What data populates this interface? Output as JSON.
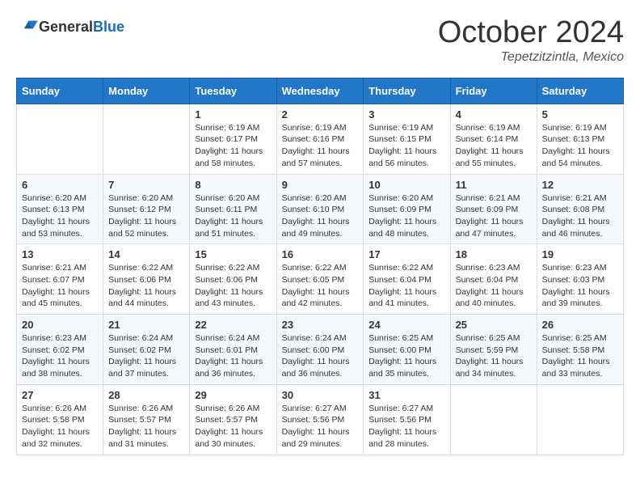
{
  "header": {
    "logo_general": "General",
    "logo_blue": "Blue",
    "month": "October 2024",
    "location": "Tepetzitzintla, Mexico"
  },
  "weekdays": [
    "Sunday",
    "Monday",
    "Tuesday",
    "Wednesday",
    "Thursday",
    "Friday",
    "Saturday"
  ],
  "weeks": [
    [
      {
        "day": "",
        "info": ""
      },
      {
        "day": "",
        "info": ""
      },
      {
        "day": "1",
        "info": "Sunrise: 6:19 AM\nSunset: 6:17 PM\nDaylight: 11 hours and 58 minutes."
      },
      {
        "day": "2",
        "info": "Sunrise: 6:19 AM\nSunset: 6:16 PM\nDaylight: 11 hours and 57 minutes."
      },
      {
        "day": "3",
        "info": "Sunrise: 6:19 AM\nSunset: 6:15 PM\nDaylight: 11 hours and 56 minutes."
      },
      {
        "day": "4",
        "info": "Sunrise: 6:19 AM\nSunset: 6:14 PM\nDaylight: 11 hours and 55 minutes."
      },
      {
        "day": "5",
        "info": "Sunrise: 6:19 AM\nSunset: 6:13 PM\nDaylight: 11 hours and 54 minutes."
      }
    ],
    [
      {
        "day": "6",
        "info": "Sunrise: 6:20 AM\nSunset: 6:13 PM\nDaylight: 11 hours and 53 minutes."
      },
      {
        "day": "7",
        "info": "Sunrise: 6:20 AM\nSunset: 6:12 PM\nDaylight: 11 hours and 52 minutes."
      },
      {
        "day": "8",
        "info": "Sunrise: 6:20 AM\nSunset: 6:11 PM\nDaylight: 11 hours and 51 minutes."
      },
      {
        "day": "9",
        "info": "Sunrise: 6:20 AM\nSunset: 6:10 PM\nDaylight: 11 hours and 49 minutes."
      },
      {
        "day": "10",
        "info": "Sunrise: 6:20 AM\nSunset: 6:09 PM\nDaylight: 11 hours and 48 minutes."
      },
      {
        "day": "11",
        "info": "Sunrise: 6:21 AM\nSunset: 6:09 PM\nDaylight: 11 hours and 47 minutes."
      },
      {
        "day": "12",
        "info": "Sunrise: 6:21 AM\nSunset: 6:08 PM\nDaylight: 11 hours and 46 minutes."
      }
    ],
    [
      {
        "day": "13",
        "info": "Sunrise: 6:21 AM\nSunset: 6:07 PM\nDaylight: 11 hours and 45 minutes."
      },
      {
        "day": "14",
        "info": "Sunrise: 6:22 AM\nSunset: 6:06 PM\nDaylight: 11 hours and 44 minutes."
      },
      {
        "day": "15",
        "info": "Sunrise: 6:22 AM\nSunset: 6:06 PM\nDaylight: 11 hours and 43 minutes."
      },
      {
        "day": "16",
        "info": "Sunrise: 6:22 AM\nSunset: 6:05 PM\nDaylight: 11 hours and 42 minutes."
      },
      {
        "day": "17",
        "info": "Sunrise: 6:22 AM\nSunset: 6:04 PM\nDaylight: 11 hours and 41 minutes."
      },
      {
        "day": "18",
        "info": "Sunrise: 6:23 AM\nSunset: 6:04 PM\nDaylight: 11 hours and 40 minutes."
      },
      {
        "day": "19",
        "info": "Sunrise: 6:23 AM\nSunset: 6:03 PM\nDaylight: 11 hours and 39 minutes."
      }
    ],
    [
      {
        "day": "20",
        "info": "Sunrise: 6:23 AM\nSunset: 6:02 PM\nDaylight: 11 hours and 38 minutes."
      },
      {
        "day": "21",
        "info": "Sunrise: 6:24 AM\nSunset: 6:02 PM\nDaylight: 11 hours and 37 minutes."
      },
      {
        "day": "22",
        "info": "Sunrise: 6:24 AM\nSunset: 6:01 PM\nDaylight: 11 hours and 36 minutes."
      },
      {
        "day": "23",
        "info": "Sunrise: 6:24 AM\nSunset: 6:00 PM\nDaylight: 11 hours and 36 minutes."
      },
      {
        "day": "24",
        "info": "Sunrise: 6:25 AM\nSunset: 6:00 PM\nDaylight: 11 hours and 35 minutes."
      },
      {
        "day": "25",
        "info": "Sunrise: 6:25 AM\nSunset: 5:59 PM\nDaylight: 11 hours and 34 minutes."
      },
      {
        "day": "26",
        "info": "Sunrise: 6:25 AM\nSunset: 5:58 PM\nDaylight: 11 hours and 33 minutes."
      }
    ],
    [
      {
        "day": "27",
        "info": "Sunrise: 6:26 AM\nSunset: 5:58 PM\nDaylight: 11 hours and 32 minutes."
      },
      {
        "day": "28",
        "info": "Sunrise: 6:26 AM\nSunset: 5:57 PM\nDaylight: 11 hours and 31 minutes."
      },
      {
        "day": "29",
        "info": "Sunrise: 6:26 AM\nSunset: 5:57 PM\nDaylight: 11 hours and 30 minutes."
      },
      {
        "day": "30",
        "info": "Sunrise: 6:27 AM\nSunset: 5:56 PM\nDaylight: 11 hours and 29 minutes."
      },
      {
        "day": "31",
        "info": "Sunrise: 6:27 AM\nSunset: 5:56 PM\nDaylight: 11 hours and 28 minutes."
      },
      {
        "day": "",
        "info": ""
      },
      {
        "day": "",
        "info": ""
      }
    ]
  ]
}
